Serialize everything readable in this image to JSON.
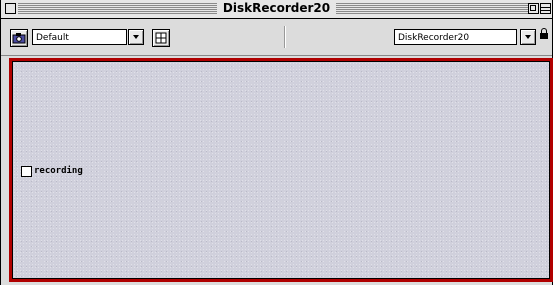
{
  "window": {
    "title": "DiskRecorder20"
  },
  "toolbar": {
    "camera_icon": "camera-icon",
    "view_popup": {
      "value": "Default"
    },
    "grid_icon": "grid-icon",
    "patcher_popup": {
      "value": "DiskRecorder20"
    },
    "lock_icon": "lock-icon"
  },
  "canvas": {
    "border_color": "#b00000",
    "background_color": "#d0d0dc",
    "toggle": {
      "label": "recording",
      "checked": false
    }
  }
}
